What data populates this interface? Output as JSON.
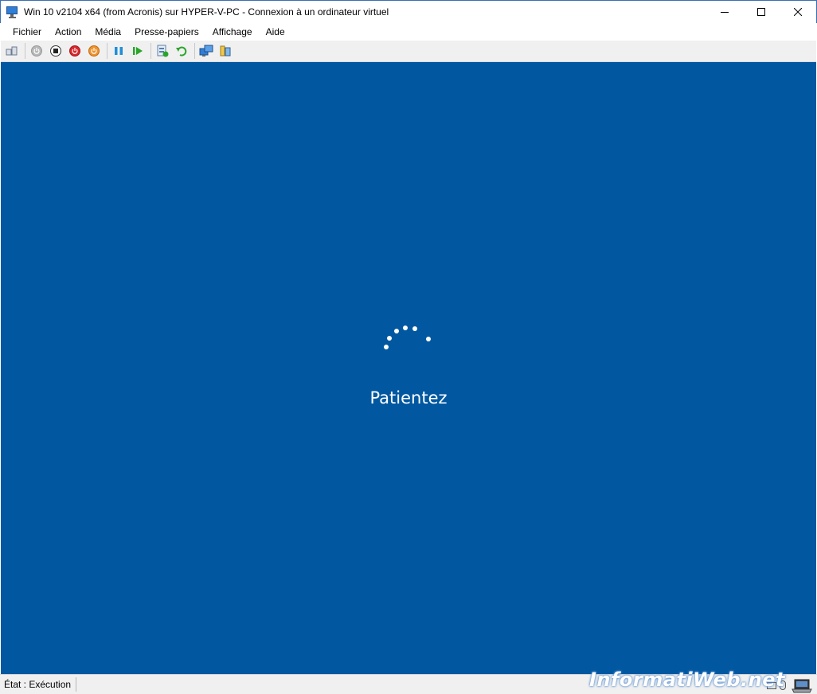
{
  "window": {
    "title": "Win 10 v2104 x64 (from Acronis) sur HYPER-V-PC - Connexion à un ordinateur virtuel"
  },
  "menu": {
    "items": [
      "Fichier",
      "Action",
      "Média",
      "Presse-papiers",
      "Affichage",
      "Aide"
    ]
  },
  "toolbar": {
    "icons": [
      "ctrl-alt-del-icon",
      "start-icon",
      "turn-off-icon",
      "shutdown-icon",
      "save-icon",
      "pause-icon",
      "resume-icon",
      "checkpoint-icon",
      "revert-icon",
      "enhanced-session-icon",
      "share-icon"
    ]
  },
  "vm": {
    "background": "#0158a1",
    "message": "Patientez"
  },
  "status": {
    "text": "État : Exécution"
  },
  "watermark": {
    "text": "InformatiWeb.net"
  }
}
